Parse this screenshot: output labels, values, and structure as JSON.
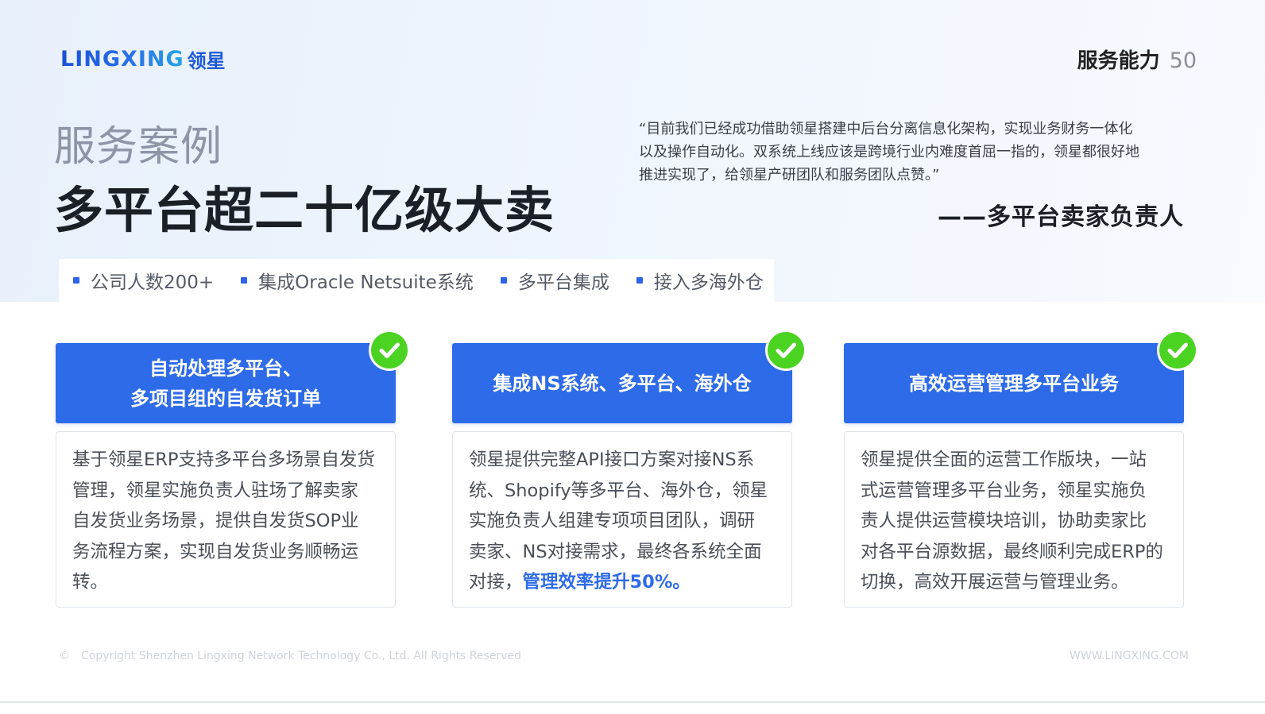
{
  "header": {
    "logo_en": "LINGXING",
    "logo_cn": "领星",
    "section_title": "服务能力",
    "page_number": "50"
  },
  "intro": {
    "case_label": "服务案例",
    "case_title": "多平台超二十亿级大卖",
    "quote_lines": [
      "“目前我们已经成功借助领星搭建中后台分离信息化架构，实现业务财务一体化",
      "以及操作自动化。双系统上线应该是跨境行业内难度首屈一指的，领星都很好地",
      "推进实现了，给领星产研团队和服务团队点赞。”"
    ],
    "quote_author": "——多平台卖家负责人"
  },
  "tags": [
    "公司人数200+",
    "集成Oracle Netsuite系统",
    "多平台集成",
    "接入多海外仓"
  ],
  "cards": [
    {
      "title_lines": [
        "自动处理多平台、",
        "多项目组的自发货订单"
      ],
      "body_lines": [
        "基于领星ERP支持多平台多场景自发货",
        "管理，领星实施负责人驻场了解卖家",
        "自发货业务场景，提供自发货SOP业",
        "务流程方案，实现自发货业务顺畅运",
        "转。"
      ]
    },
    {
      "title_lines": [
        "集成NS系统、多平台、海外仓"
      ],
      "body_lines": [
        "领星提供完整API接口方案对接NS系",
        "统、Shopify等多平台、海外仓，领星",
        "实施负责人组建专项项目团队，调研",
        "卖家、NS对接需求，最终各系统全面"
      ],
      "body_last_prefix": "对接，",
      "body_highlight": "管理效率提升50%。"
    },
    {
      "title_lines": [
        "高效运营管理多平台业务"
      ],
      "body_lines": [
        "领星提供全面的运营工作版块，一站",
        "式运营管理多平台业务，领星实施负",
        "责人提供运营模块培训，协助卖家比",
        "对各平台源数据，最终顺利完成ERP的",
        "切换，高效开展运营与管理业务。"
      ]
    }
  ],
  "footer": {
    "copyright_symbol": "©",
    "copyright": "Copyright Shenzhen Lingxing Network Technology Co., Ltd. All Rights Reserved",
    "website": "WWW.LINGXING.COM"
  },
  "colors": {
    "accent": "#2e6be8",
    "check": "#4bd321"
  }
}
